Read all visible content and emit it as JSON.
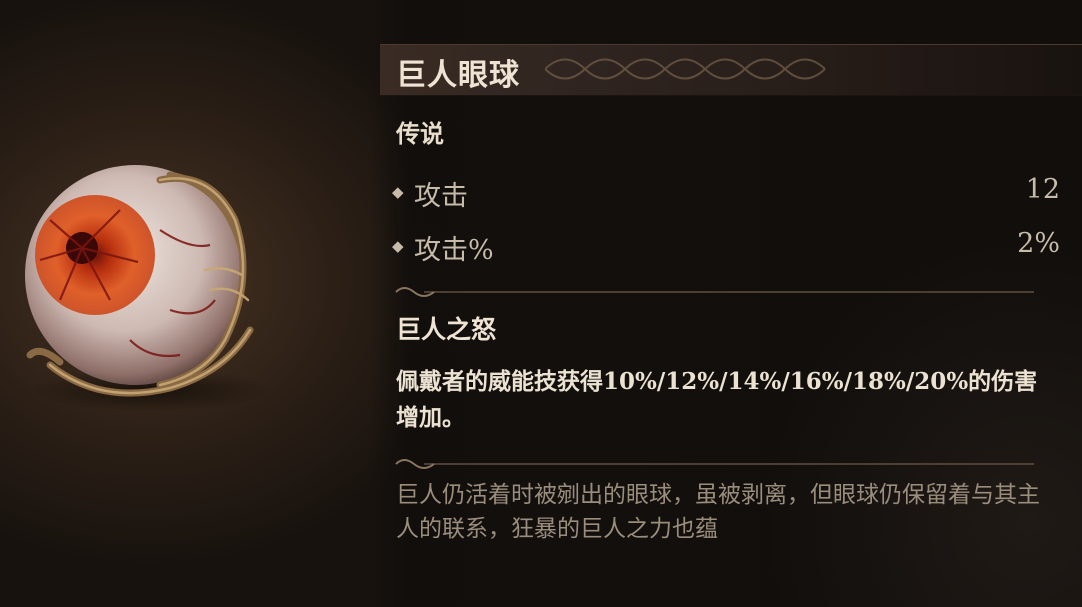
{
  "item": {
    "name": "巨人眼球",
    "rarity": "传说",
    "image_icon": "giant-eyeball-icon"
  },
  "stats": [
    {
      "label": "攻击",
      "value": "12"
    },
    {
      "label": "攻击%",
      "value": "2%"
    }
  ],
  "ability": {
    "title": "巨人之怒",
    "description": "佩戴者的威能技获得10%/12%/14%/16%/18%/20%的伤害增加。"
  },
  "flavor_text": "巨人仍活着时被剜出的眼球，虽被剥离，但眼球仍保留着与其主人的联系，狂暴的巨人之力也蕴",
  "colors": {
    "background": "#14100d",
    "title_text": "#efe4d4",
    "stat_text": "#c7bba9",
    "flavor_text": "#9a8d7c",
    "ornament": "#6e5a45"
  }
}
